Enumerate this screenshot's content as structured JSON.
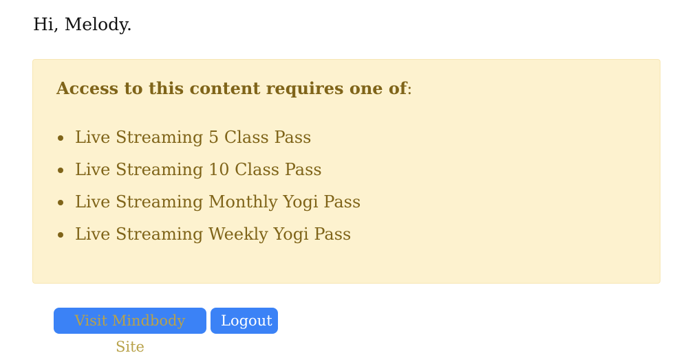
{
  "greeting": "Hi, Melody.",
  "notice": {
    "heading": "Access to this content requires one of",
    "heading_colon": ":",
    "passes": [
      "Live Streaming 5 Class Pass",
      "Live Streaming 10 Class Pass",
      "Live Streaming Monthly Yogi Pass",
      "Live Streaming Weekly Yogi Pass"
    ]
  },
  "actions": {
    "visit_label": "Visit Mindbody Site",
    "logout_label": "Logout"
  },
  "colors": {
    "notice_background": "#fdf2cf",
    "notice_text": "#7f6419",
    "button_background": "#3b82f6"
  }
}
